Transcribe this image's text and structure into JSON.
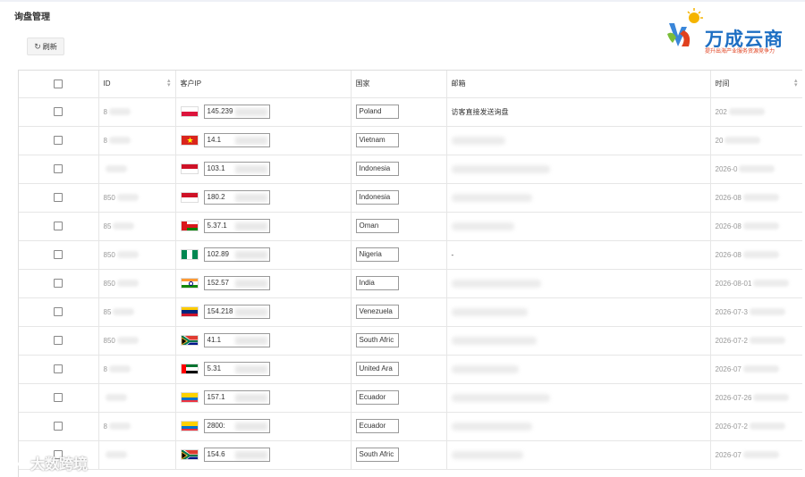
{
  "header": {
    "title": "询盘管理"
  },
  "toolbar": {
    "refresh_label": "刷新"
  },
  "logo": {
    "brand": "万成云商",
    "slogan": "提升出海产业服务资源竞争力"
  },
  "table": {
    "columns": [
      "ID",
      "客户IP",
      "国家",
      "邮箱",
      "时间"
    ],
    "rows": [
      {
        "id": "8",
        "flag": "poland",
        "ip": "145.239",
        "country": "Poland",
        "email": "访客直接发送询盘",
        "email_blur": false,
        "time": "202"
      },
      {
        "id": "8",
        "flag": "vietnam",
        "ip": "14.1",
        "country": "Vietnam",
        "email": "",
        "email_blur": true,
        "time": "20"
      },
      {
        "id": "",
        "flag": "indonesia",
        "ip": "103.1",
        "country": "Indonesia",
        "email": "",
        "email_blur": true,
        "time": "2026-0"
      },
      {
        "id": "850",
        "flag": "indonesia",
        "ip": "180.2",
        "country": "Indonesia",
        "email": "",
        "email_blur": true,
        "time": "2026-08"
      },
      {
        "id": "85",
        "flag": "oman",
        "ip": "5.37.1",
        "country": "Oman",
        "email": "",
        "email_blur": true,
        "time": "2026-08"
      },
      {
        "id": "850",
        "flag": "nigeria",
        "ip": "102.89",
        "country": "Nigeria",
        "email": "-",
        "email_blur": false,
        "time": "2026-08"
      },
      {
        "id": "850",
        "flag": "india",
        "ip": "152.57",
        "country": "India",
        "email": "",
        "email_blur": true,
        "time": "2026-08-01"
      },
      {
        "id": "85",
        "flag": "venezuela",
        "ip": "154.218",
        "country": "Venezuela",
        "email": "",
        "email_blur": true,
        "time": "2026-07-3"
      },
      {
        "id": "850",
        "flag": "southafrica",
        "ip": "41.1",
        "country": "South Afric",
        "email": "",
        "email_blur": true,
        "time": "2026-07-2"
      },
      {
        "id": "8",
        "flag": "uae",
        "ip": "5.31",
        "country": "United Ara",
        "email": "",
        "email_blur": true,
        "time": "2026-07"
      },
      {
        "id": "",
        "flag": "ecuador",
        "ip": "157.1",
        "country": "Ecuador",
        "email": "",
        "email_blur": true,
        "time": "2026-07-26"
      },
      {
        "id": "8",
        "flag": "ecuador",
        "ip": "2800:",
        "country": "Ecuador",
        "email": "",
        "email_blur": true,
        "time": "2026-07-2"
      },
      {
        "id": "",
        "flag": "southafrica",
        "ip": "154.6",
        "country": "South Afric",
        "email": "",
        "email_blur": true,
        "time": "2026-07"
      }
    ]
  },
  "watermark": {
    "text": "大数跨境"
  }
}
